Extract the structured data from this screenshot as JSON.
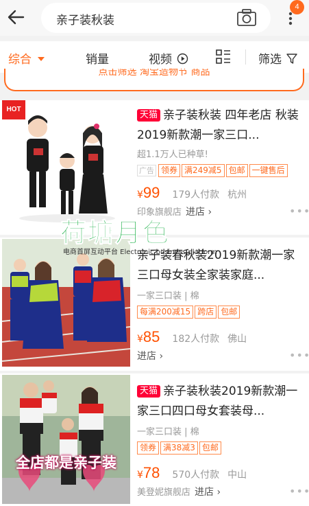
{
  "header": {
    "search_query": "亲子装秋装",
    "notification_count": "4"
  },
  "sortbar": {
    "items": [
      "综合",
      "销量",
      "视频",
      "筛选"
    ]
  },
  "promo": {
    "text": "点击筛选  淘宝造物节  商品"
  },
  "items": [
    {
      "is_tmall": true,
      "tmall_label": "天猫",
      "title": "亲子装秋装 四年老店 秋装2019新款潮一家三口...",
      "subtitle": "超1.1万人已种草!",
      "ad_label": "广告",
      "tags": [
        "领券",
        "满249减5",
        "包邮",
        "一键售后"
      ],
      "currency": "¥",
      "price": "99",
      "sales": "179人付款",
      "location": "杭州",
      "shop": "印象旗舰店",
      "enter": "进店 ›",
      "hot": "HOT"
    },
    {
      "is_tmall": false,
      "title": "亲子装春秋装2019新款潮一家三口母女装全家装家庭...",
      "subtitle": "一家三口装 | 棉",
      "tags": [
        "每满200减15",
        "跨店",
        "包邮"
      ],
      "currency": "¥",
      "price": "85",
      "sales": "182人付款",
      "location": "佛山",
      "shop": "",
      "enter": "进店 ›"
    },
    {
      "is_tmall": true,
      "tmall_label": "天猫",
      "title": "亲子装秋装2019新款潮一家三口四口母女套装母...",
      "subtitle": "一家三口装 | 棉",
      "tags": [
        "领券",
        "满38减3",
        "包邮"
      ],
      "currency": "¥",
      "price": "78",
      "sales": "570人付款",
      "location": "中山",
      "shop": "美登妮旗舰店",
      "enter": "进店 ›",
      "banner": "全店都是亲子装"
    }
  ],
  "watermark": {
    "title": "荷塘月色",
    "subtitle": "电商首屏互动平台 Electronic business platform"
  },
  "colors": {
    "accent": "#ff6a1e",
    "price": "#ff5000",
    "tmall": "#ff0036"
  }
}
